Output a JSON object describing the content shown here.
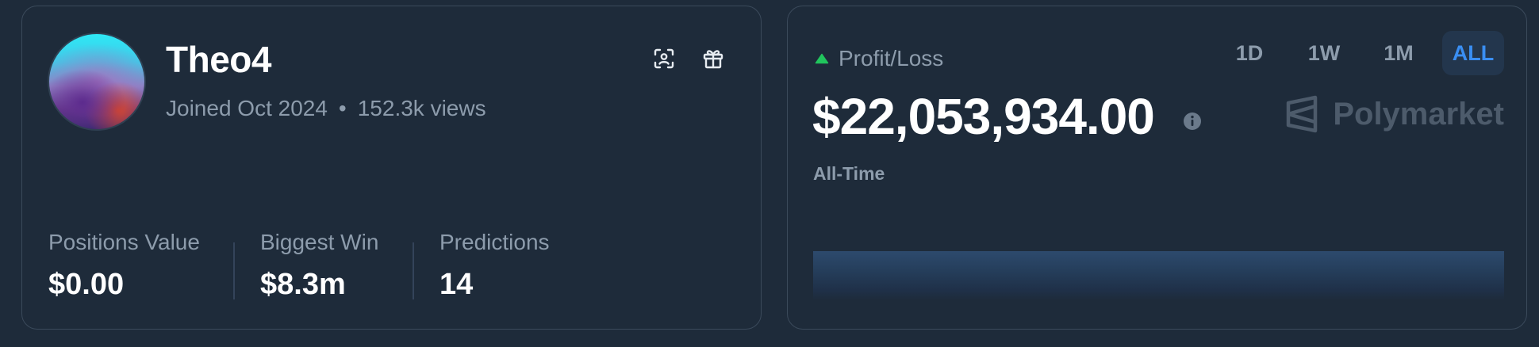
{
  "profile": {
    "username": "Theo4",
    "joined": "Joined Oct 2024",
    "separator": "•",
    "views": "152.3k views",
    "icons": {
      "scan": "scan-face-icon",
      "gift": "gift-icon"
    },
    "stats": [
      {
        "label": "Positions Value",
        "value": "$0.00"
      },
      {
        "label": "Biggest Win",
        "value": "$8.3m"
      },
      {
        "label": "Predictions",
        "value": "14"
      }
    ]
  },
  "pnl": {
    "label": "Profit/Loss",
    "amount": "$22,053,934.00",
    "period": "All-Time",
    "ranges": [
      "1D",
      "1W",
      "1M",
      "ALL"
    ],
    "active_range": "ALL",
    "brand": "Polymarket",
    "colors": {
      "up_indicator": "#21c55d",
      "active_tab_text": "#3a8ef2",
      "active_tab_bg": "#23364d",
      "background": "#1e2b3a"
    }
  }
}
